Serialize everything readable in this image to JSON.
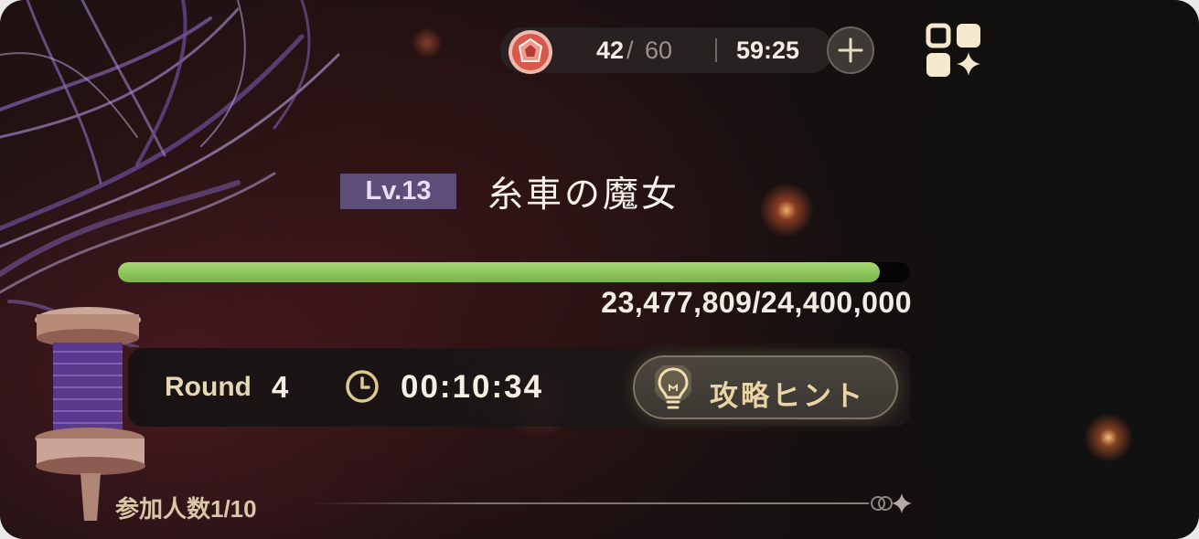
{
  "stamina": {
    "current": "42",
    "slash": "/",
    "max": "60",
    "regen_timer": "59:25",
    "icon": "gem-icon",
    "add_icon": "plus-icon"
  },
  "menu": {
    "icon": "grid-menu-icon"
  },
  "boss": {
    "level": "Lv.13",
    "name": "糸車の魔女",
    "hp_text": "23,477,809/24,400,000",
    "hp_current": 23477809,
    "hp_max": 24400000
  },
  "status": {
    "round_label": "Round",
    "round_value": "4",
    "time_icon": "clock-icon",
    "elapsed": "00:10:34",
    "hint_icon": "lightbulb-icon",
    "hint_label": "攻略ヒント"
  },
  "participants": {
    "label": "参加人数1/10"
  },
  "colors": {
    "hp_bar": "#8cc45a",
    "level_badge": "#5c4e79",
    "accent_gold": "#e6d6b2",
    "gem": "#e0544c"
  }
}
